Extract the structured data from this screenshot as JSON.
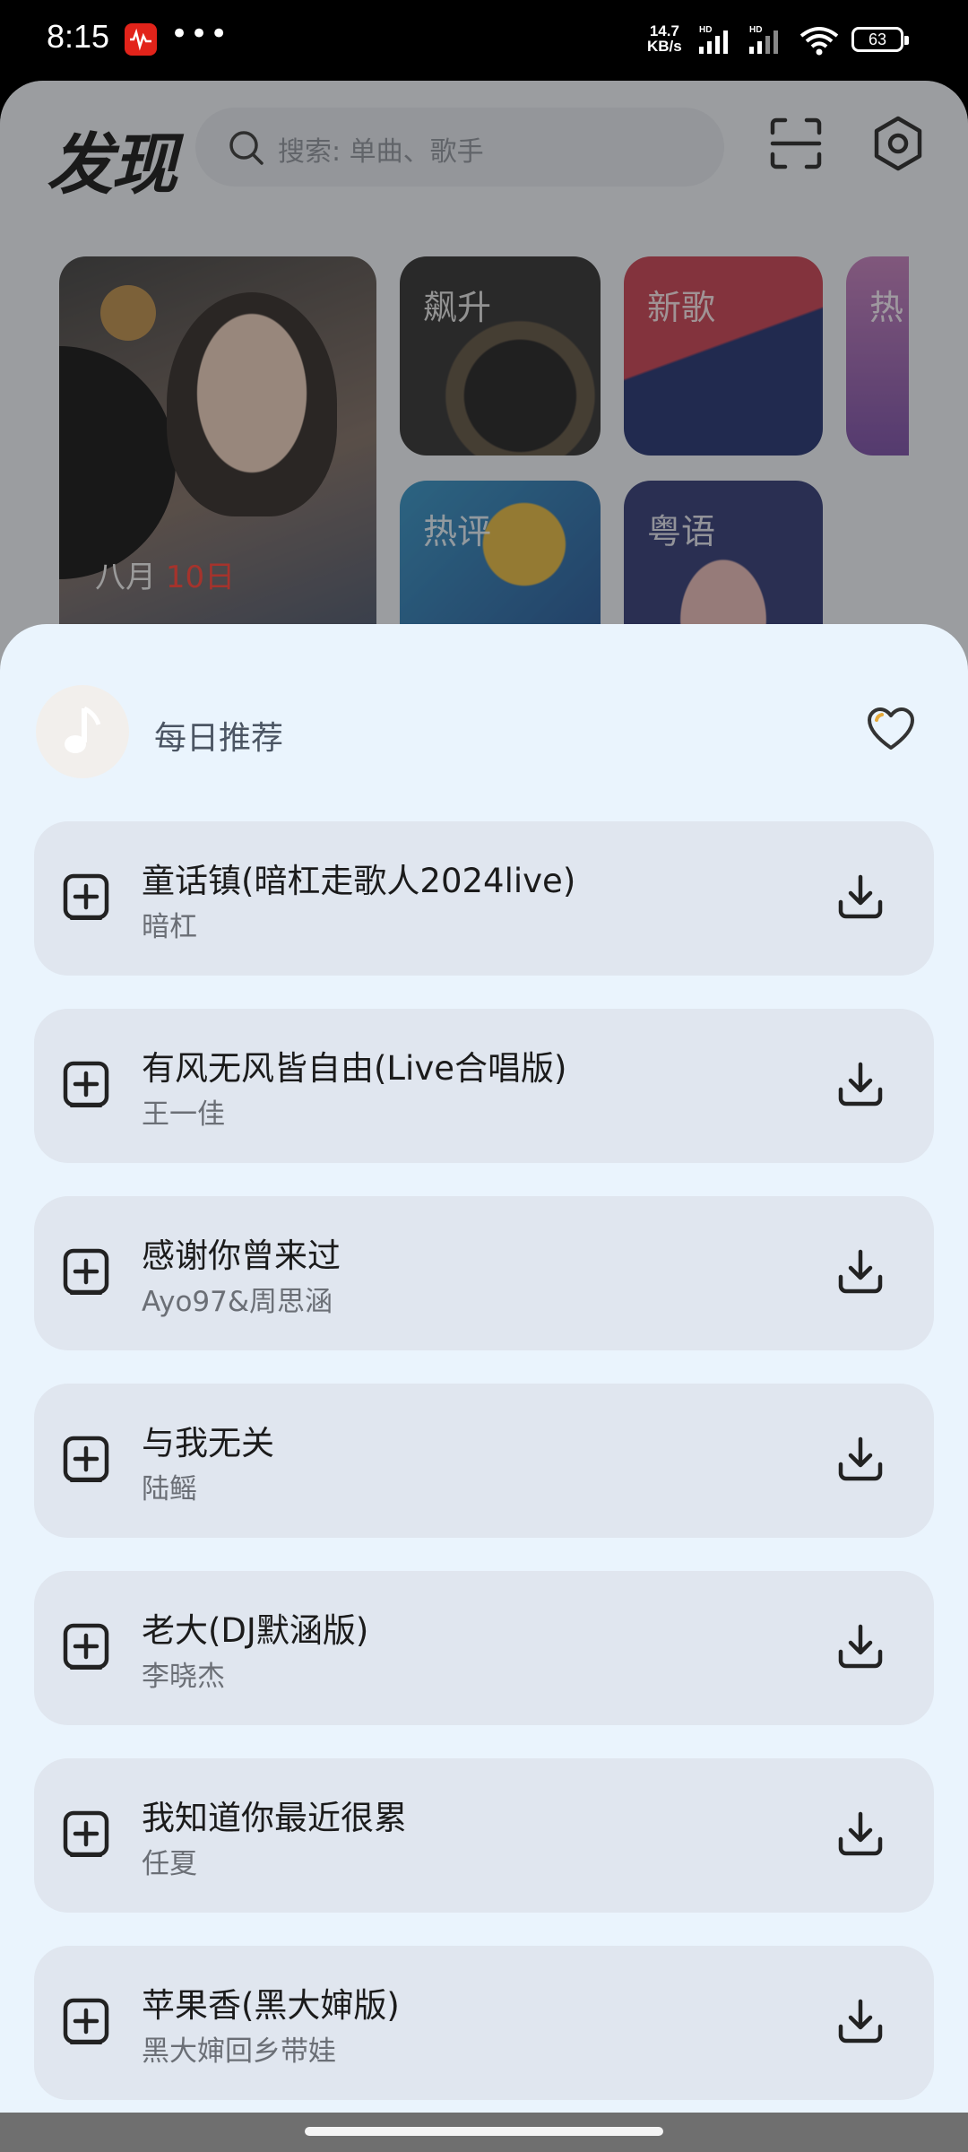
{
  "status_bar": {
    "time": "8:15",
    "more": "•••",
    "net_speed_value": "14.7",
    "net_speed_unit": "KB/s",
    "battery": "63"
  },
  "app": {
    "title": "发现",
    "search_placeholder": "搜索: 单曲、歌手",
    "cards": [
      {
        "label": "飙升"
      },
      {
        "label": "新歌"
      },
      {
        "label": "热"
      },
      {
        "label": "热评"
      },
      {
        "label": "粤语"
      }
    ],
    "daily_card": {
      "month": "八月",
      "day": "10日"
    }
  },
  "sheet": {
    "title": "每日推荐",
    "songs": [
      {
        "title": "童话镇(暗杠走歌人2024live)",
        "artist": "暗杠"
      },
      {
        "title": "有风无风皆自由(Live合唱版)",
        "artist": "王一佳"
      },
      {
        "title": "感谢你曾来过",
        "artist": "Ayo97&周思涵"
      },
      {
        "title": "与我无关",
        "artist": "陆鳐"
      },
      {
        "title": "老大(DJ默涵版)",
        "artist": "李晓杰"
      },
      {
        "title": "我知道你最近很累",
        "artist": "任夏"
      },
      {
        "title": "苹果香(黑大婶版)",
        "artist": "黑大婶回乡带娃"
      }
    ]
  },
  "colors": {
    "sheet_bg": "#eaf4fd",
    "song_card_bg": "#e0e6ef",
    "accent_red": "#ff3b30"
  }
}
